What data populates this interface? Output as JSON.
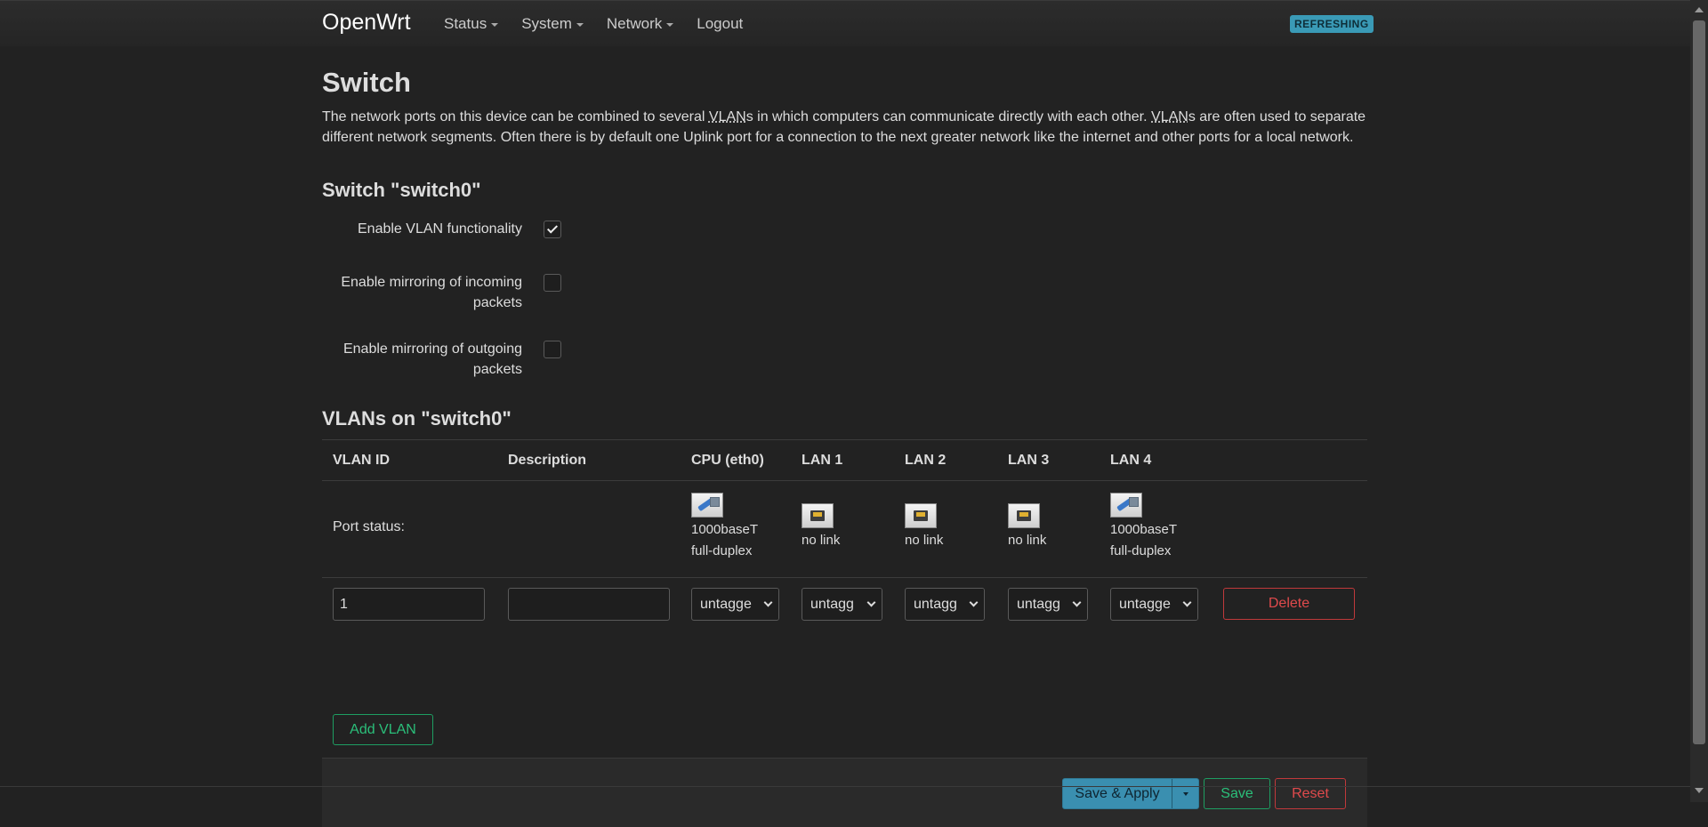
{
  "header": {
    "brand": "OpenWrt",
    "nav": [
      {
        "label": "Status",
        "dropdown": true
      },
      {
        "label": "System",
        "dropdown": true
      },
      {
        "label": "Network",
        "dropdown": true
      },
      {
        "label": "Logout",
        "dropdown": false
      }
    ],
    "badge": "REFRESHING"
  },
  "page": {
    "title": "Switch",
    "description": {
      "part1": "The network ports on this device can be combined to several ",
      "abbr1": "VLAN",
      "part2": "s in which computers can communicate directly with each other. ",
      "abbr2": "VLAN",
      "part3": "s are often used to separate different network segments. Often there is by default one Uplink port for a connection to the next greater network like the internet and other ports for a local network."
    }
  },
  "switch_section": {
    "title": "Switch \"switch0\"",
    "options": [
      {
        "label": "Enable VLAN functionality",
        "checked": true
      },
      {
        "label": "Enable mirroring of incoming packets",
        "checked": false
      },
      {
        "label": "Enable mirroring of outgoing packets",
        "checked": false
      }
    ]
  },
  "vlan_section": {
    "title": "VLANs on \"switch0\"",
    "columns": [
      "VLAN ID",
      "Description",
      "CPU (eth0)",
      "LAN 1",
      "LAN 2",
      "LAN 3",
      "LAN 4"
    ],
    "port_status_label": "Port status:",
    "ports": [
      {
        "icon": "ethernet-link-icon",
        "line1": "1000baseT",
        "line2": "full-duplex"
      },
      {
        "icon": "ethernet-nolink-icon",
        "line1": "no link",
        "line2": ""
      },
      {
        "icon": "ethernet-nolink-icon",
        "line1": "no link",
        "line2": ""
      },
      {
        "icon": "ethernet-nolink-icon",
        "line1": "no link",
        "line2": ""
      },
      {
        "icon": "ethernet-link-icon",
        "line1": "1000baseT",
        "line2": "full-duplex"
      }
    ],
    "rows": [
      {
        "vlan_id": "1",
        "description": "",
        "port_values": [
          "untagged",
          "untagged",
          "untagged",
          "untagged",
          "untagged"
        ],
        "port_display": [
          "untagge",
          "untagg",
          "untagg",
          "untagg",
          "untagge"
        ],
        "delete_label": "Delete"
      }
    ],
    "add_label": "Add VLAN"
  },
  "actions": {
    "save_apply": "Save & Apply",
    "save": "Save",
    "reset": "Reset"
  },
  "colors": {
    "background": "#222222",
    "accent_blue": "#3a8fb0",
    "positive": "#2bbf7a",
    "negative": "#e04a4c"
  }
}
